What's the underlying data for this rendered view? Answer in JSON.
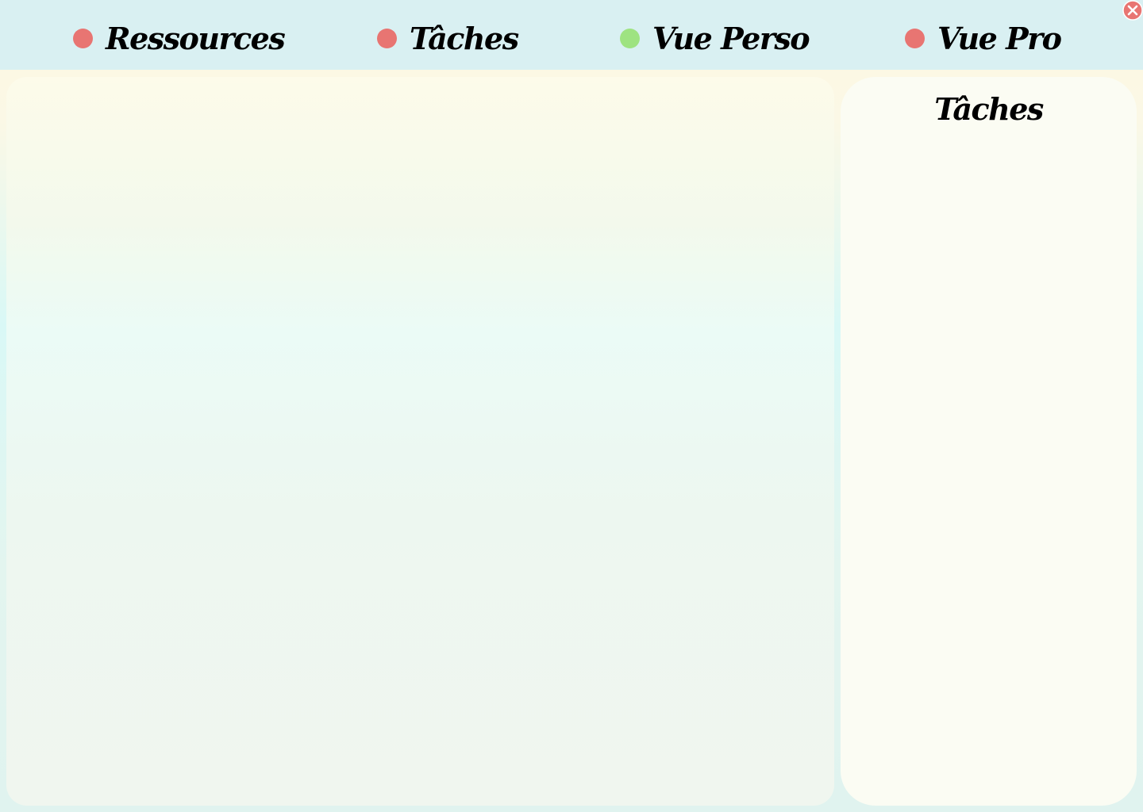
{
  "nav": {
    "items": [
      {
        "label": "Ressources",
        "status_color": "#e87572"
      },
      {
        "label": "Tâches",
        "status_color": "#e87572"
      },
      {
        "label": "Vue Perso",
        "status_color": "#9ee381"
      },
      {
        "label": "Vue Pro",
        "status_color": "#e87572"
      }
    ]
  },
  "close_icon": "close-icon",
  "close_color": "#e87572",
  "side_panel": {
    "title": "Tâches"
  }
}
